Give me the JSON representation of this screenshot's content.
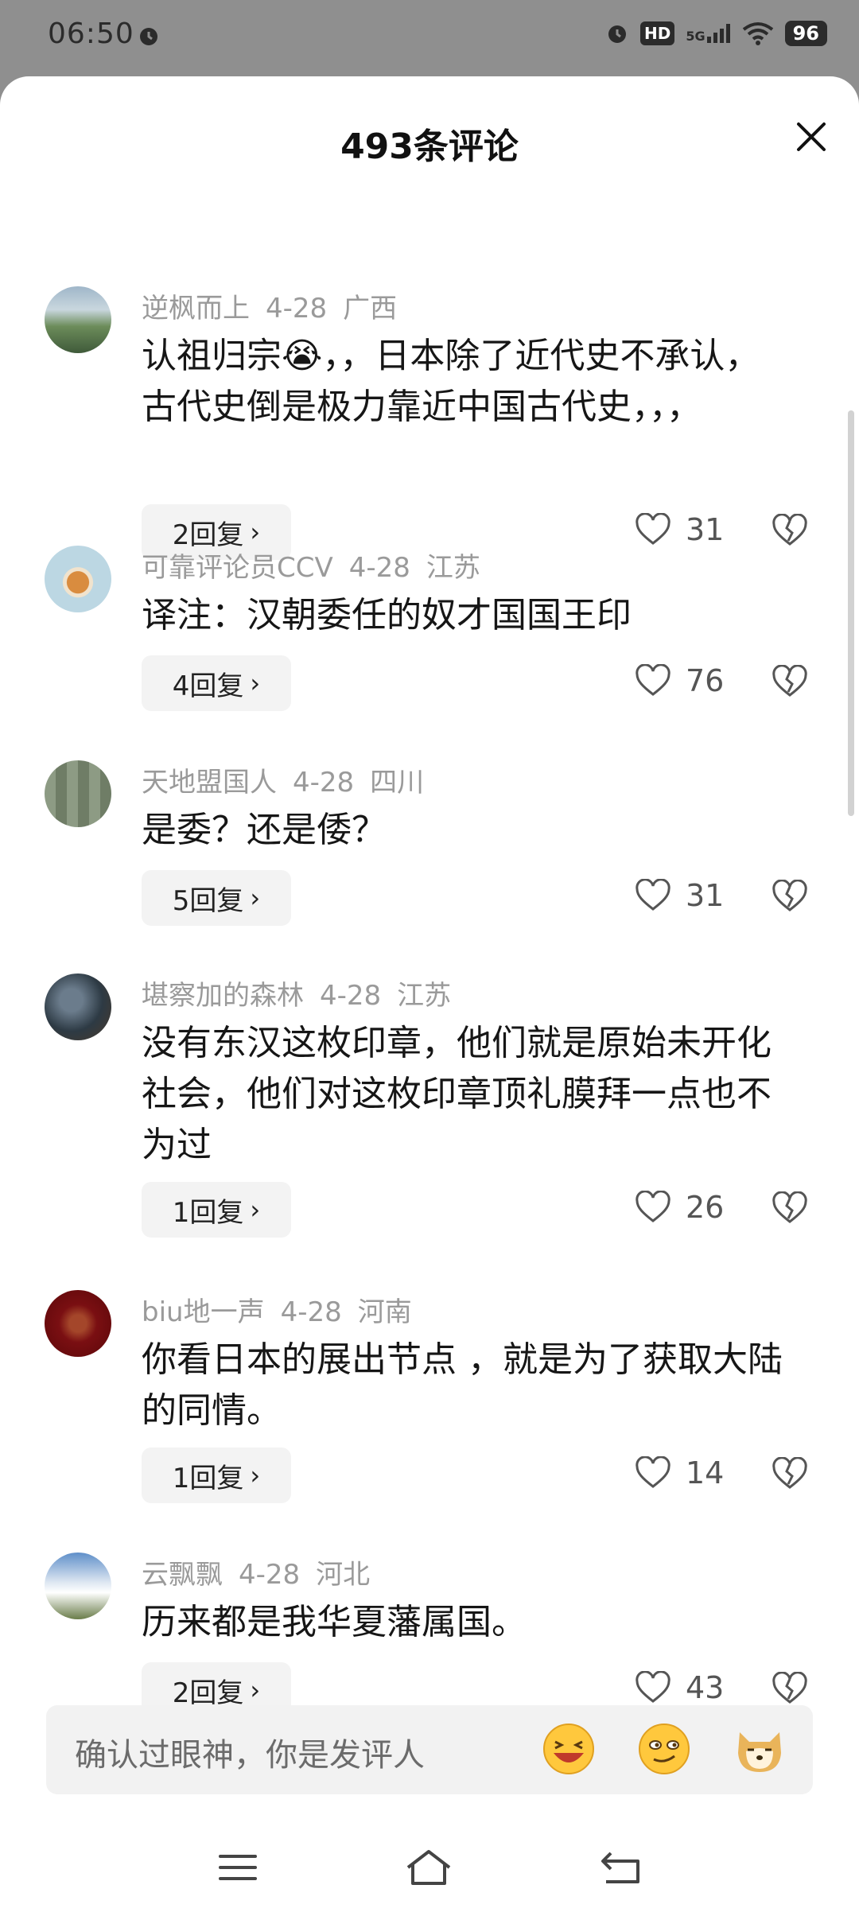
{
  "status_bar": {
    "time": "06:50",
    "hd": "HD",
    "network": "5G",
    "battery": "96"
  },
  "sheet": {
    "title": "493条评论"
  },
  "comments": [
    {
      "user": "逆枫而上",
      "date": "4-28",
      "region": "广西",
      "text": "认祖归宗😭，，日本除了近代史不承认，古代史倒是极力靠近中国古代史，，，",
      "replies": "2回复",
      "likes": "31"
    },
    {
      "user": "可靠评论员CCV",
      "date": "4-28",
      "region": "江苏",
      "text": "译注：汉朝委任的奴才国国王印",
      "replies": "4回复",
      "likes": "76"
    },
    {
      "user": "天地盟国人",
      "date": "4-28",
      "region": "四川",
      "text": "是委？还是倭？",
      "replies": "5回复",
      "likes": "31"
    },
    {
      "user": "堪察加的森林",
      "date": "4-28",
      "region": "江苏",
      "text": "没有东汉这枚印章，他们就是原始未开化社会，他们对这枚印章顶礼膜拜一点也不为过",
      "replies": "1回复",
      "likes": "26"
    },
    {
      "user": "biu地一声",
      "date": "4-28",
      "region": "河南",
      "text": "你看日本的展出节点 ，就是为了获取大陆的同情。",
      "replies": "1回复",
      "likes": "14"
    },
    {
      "user": "云飘飘",
      "date": "4-28",
      "region": "河北",
      "text": "历来都是我华夏藩属国。",
      "replies": "2回复",
      "likes": "43"
    }
  ],
  "input": {
    "placeholder": "确认过眼神，你是发评人"
  },
  "icons": {
    "close": "close-icon",
    "like": "heart-icon",
    "dislike": "broken-heart-icon",
    "emoji1": "laughing-emoji-icon",
    "emoji2": "smug-emoji-icon",
    "emoji3": "doge-emoji-icon",
    "nav_menu": "menu-icon",
    "nav_home": "home-icon",
    "nav_back": "back-icon"
  },
  "colors": {
    "meta_text": "#9a9a9a",
    "reply_bg": "#f3f3f3",
    "input_bg": "#f2f2f2"
  }
}
